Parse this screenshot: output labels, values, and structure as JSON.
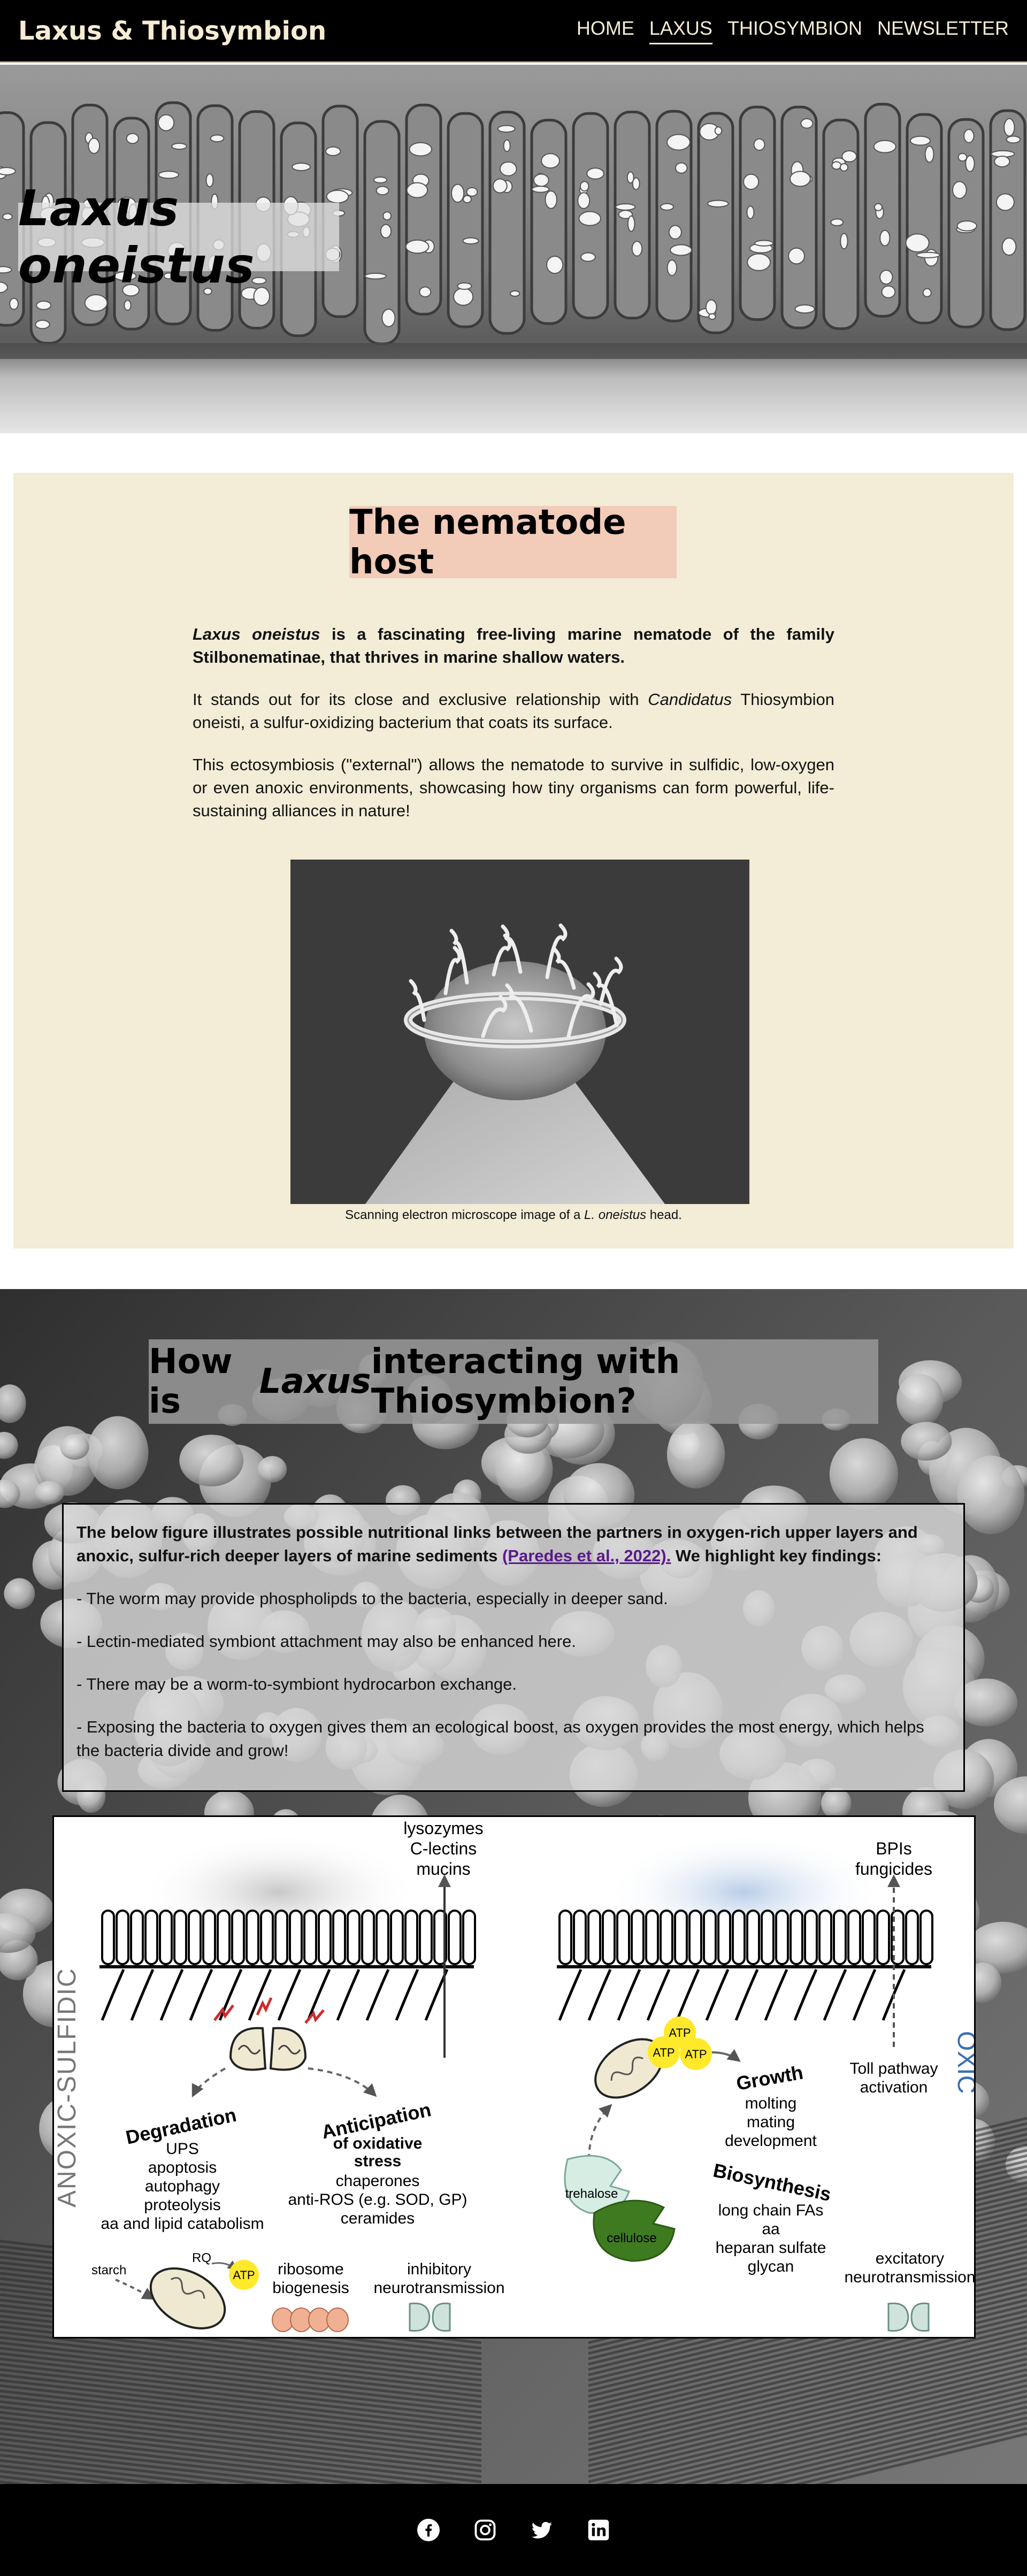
{
  "nav": {
    "brand": "Laxus & Thiosymbion",
    "items": [
      {
        "label": "HOME"
      },
      {
        "label": "LAXUS",
        "active": true
      },
      {
        "label": "THIOSYMBION"
      },
      {
        "label": "NEWSLETTER"
      }
    ]
  },
  "hero": {
    "title": "Laxus oneistus"
  },
  "host": {
    "heading": "The nematode host",
    "p1": {
      "species": "Laxus oneistus",
      "rest": " is a fascinating free-living marine nematode of the family Stilbonematinae, that thrives in marine shallow waters."
    },
    "p2": {
      "before": "It stands out for its close and exclusive relationship with ",
      "genus": "Candidatus",
      "after": " Thiosymbion oneisti, a sulfur-oxidizing bacterium that coats its surface."
    },
    "p3": "This ectosymbiosis (\"external\") allows the nematode to survive in sulfidic, low-oxygen or even anoxic environments, showcasing how tiny organisms can form powerful, life-sustaining alliances in nature!",
    "caption": {
      "before": "Scanning electron microscope image of a ",
      "species": "L. oneistus",
      "after": " head."
    }
  },
  "interaction": {
    "heading": {
      "before": "How is ",
      "italic": "Laxus",
      "after": " interacting with Thiosymbion?"
    },
    "intro": {
      "text": "The below figure illustrates possible nutritional links between the partners in oxygen-rich upper layers and anoxic, sulfur-rich deeper layers of marine sediments ",
      "link": "(Paredes et al., 2022).",
      "after": " We highlight key findings:"
    },
    "findings": [
      "- The worm may provide phospholipds to the bacteria, especially in deeper sand.",
      "- Lectin-mediated symbiont attachment may also be enhanced here.",
      "- There may be a worm-to-symbiont hydrocarbon exchange.",
      "- Exposing the bacteria to oxygen gives them an ecological boost, as oxygen provides the most energy, which helps the bacteria divide and grow!"
    ],
    "figure": {
      "left_side": "ANOXIC-SULFIDIC",
      "right_side": "OXIC",
      "lysozymes": "lysozymes",
      "clectins": "C-lectins",
      "mucins": "mucins",
      "bpis": "BPIs",
      "fungicides": "fungicides",
      "degradation": "Degradation",
      "deg_items": [
        "UPS",
        "apoptosis",
        "autophagy",
        "proteolysis",
        "aa and lipid catabolism"
      ],
      "anticipation": "Anticipation",
      "oxidative1": "of oxidative",
      "oxidative2": "stress",
      "ant_items": [
        "chaperones",
        "anti-ROS (e.g. SOD, GP)",
        "ceramides"
      ],
      "starch": "starch",
      "rq": "RQ",
      "atp": "ATP",
      "ribosome1": "ribosome",
      "ribosome2": "biogenesis",
      "inhibitory1": "inhibitory",
      "inhibitory2": "neurotransmission",
      "toll1": "Toll pathway",
      "toll2": "activation",
      "growth": "Growth",
      "growth_items": [
        "molting",
        "mating",
        "development"
      ],
      "trehalose": "trehalose",
      "cellulose": "cellulose",
      "biosynthesis": "Biosynthesis",
      "bio_items": [
        "long chain FAs",
        "aa",
        "heparan sulfate",
        "glycan"
      ],
      "excitatory1": "excitatory",
      "excitatory2": "neurotransmission"
    }
  },
  "footer": {
    "icons": [
      "facebook-icon",
      "instagram-icon",
      "twitter-icon",
      "linkedin-icon"
    ]
  },
  "colors": {
    "nav_bg": "#000000",
    "nav_text": "#f6ecd3",
    "host_bg": "#f3ecd6",
    "host_heading_bg": "#f2cbb9",
    "link": "#5a1a8a",
    "oxic_blue": "#3a6eb3"
  }
}
